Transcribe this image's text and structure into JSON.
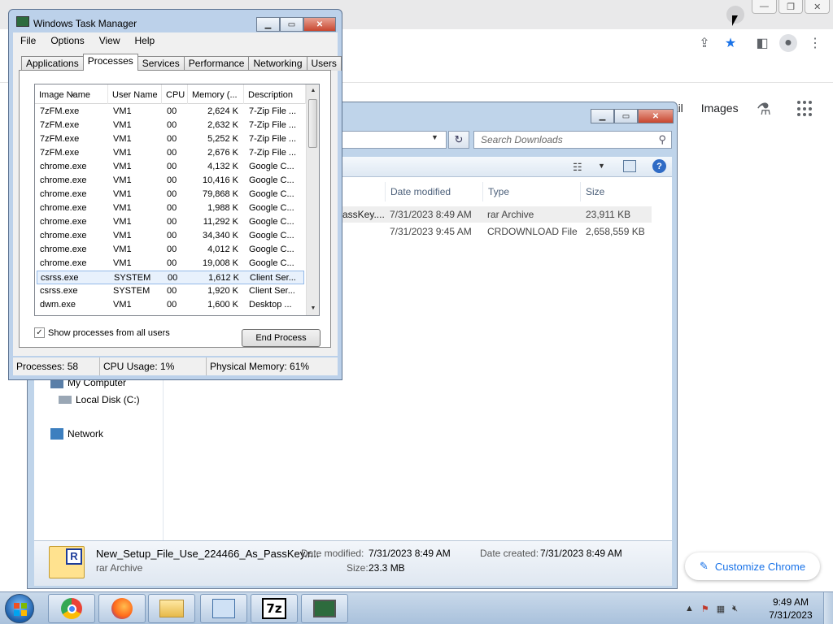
{
  "chrome": {
    "window_buttons": [
      "—",
      "❐",
      "✕"
    ],
    "tab_search_icon": "chevron-down-icon",
    "links": [
      "nail",
      "Images"
    ],
    "customize_label": "Customize Chrome"
  },
  "explorer": {
    "search_placeholder": "Search Downloads",
    "columns": [
      "Date modified",
      "Type",
      "Size"
    ],
    "files": [
      {
        "name": "assKey....",
        "date": "7/31/2023 8:49 AM",
        "type": "rar Archive",
        "size": "23,911 KB"
      },
      {
        "name": "",
        "date": "7/31/2023 9:45 AM",
        "type": "CRDOWNLOAD File",
        "size": "2,658,559 KB"
      }
    ],
    "nav": {
      "my_computer": "My Computer",
      "local_disk": "Local Disk (C:)",
      "network": "Network"
    },
    "details": {
      "filename": "New_Setup_File_Use_224466_As_PassKey.r...",
      "filetype": "rar Archive",
      "date_modified_label": "Date modified:",
      "date_modified": "7/31/2023 8:49 AM",
      "date_created_label": "Date created:",
      "date_created": "7/31/2023 8:49 AM",
      "size_label": "Size:",
      "size": "23.3 MB",
      "icon_letter": "R"
    }
  },
  "taskmgr": {
    "title": "Windows Task Manager",
    "menu": [
      "File",
      "Options",
      "View",
      "Help"
    ],
    "tabs": [
      "Applications",
      "Processes",
      "Services",
      "Performance",
      "Networking",
      "Users"
    ],
    "active_tab": "Processes",
    "columns": [
      "Image Name",
      "User Name",
      "CPU",
      "Memory (...",
      "Description"
    ],
    "processes": [
      {
        "image": "7zFM.exe",
        "user": "VM1",
        "cpu": "00",
        "mem": "2,624 K",
        "desc": "7-Zip File ..."
      },
      {
        "image": "7zFM.exe",
        "user": "VM1",
        "cpu": "00",
        "mem": "2,632 K",
        "desc": "7-Zip File ..."
      },
      {
        "image": "7zFM.exe",
        "user": "VM1",
        "cpu": "00",
        "mem": "5,252 K",
        "desc": "7-Zip File ..."
      },
      {
        "image": "7zFM.exe",
        "user": "VM1",
        "cpu": "00",
        "mem": "2,676 K",
        "desc": "7-Zip File ..."
      },
      {
        "image": "chrome.exe",
        "user": "VM1",
        "cpu": "00",
        "mem": "4,132 K",
        "desc": "Google C..."
      },
      {
        "image": "chrome.exe",
        "user": "VM1",
        "cpu": "00",
        "mem": "10,416 K",
        "desc": "Google C..."
      },
      {
        "image": "chrome.exe",
        "user": "VM1",
        "cpu": "00",
        "mem": "79,868 K",
        "desc": "Google C..."
      },
      {
        "image": "chrome.exe",
        "user": "VM1",
        "cpu": "00",
        "mem": "1,988 K",
        "desc": "Google C..."
      },
      {
        "image": "chrome.exe",
        "user": "VM1",
        "cpu": "00",
        "mem": "11,292 K",
        "desc": "Google C..."
      },
      {
        "image": "chrome.exe",
        "user": "VM1",
        "cpu": "00",
        "mem": "34,340 K",
        "desc": "Google C..."
      },
      {
        "image": "chrome.exe",
        "user": "VM1",
        "cpu": "00",
        "mem": "4,012 K",
        "desc": "Google C..."
      },
      {
        "image": "chrome.exe",
        "user": "VM1",
        "cpu": "00",
        "mem": "19,008 K",
        "desc": "Google C..."
      },
      {
        "image": "csrss.exe",
        "user": "SYSTEM",
        "cpu": "00",
        "mem": "1,612 K",
        "desc": "Client Ser..."
      },
      {
        "image": "csrss.exe",
        "user": "SYSTEM",
        "cpu": "00",
        "mem": "1,920 K",
        "desc": "Client Ser..."
      },
      {
        "image": "dwm.exe",
        "user": "VM1",
        "cpu": "00",
        "mem": "1,600 K",
        "desc": "Desktop ..."
      }
    ],
    "selected_index": 12,
    "show_all_label": "Show processes from all users",
    "show_all_checked": "✓",
    "end_process_label": "End Process",
    "status": {
      "processes": "Processes: 58",
      "cpu": "CPU Usage: 1%",
      "memory": "Physical Memory: 61%"
    }
  },
  "taskbar": {
    "apps": [
      "chrome-icon",
      "firefox-icon",
      "explorer-icon",
      "control-panel-icon",
      "7zip-icon",
      "task-manager-icon"
    ],
    "sevenzip_text": "7z",
    "time": "9:49 AM",
    "date": "7/31/2023"
  }
}
